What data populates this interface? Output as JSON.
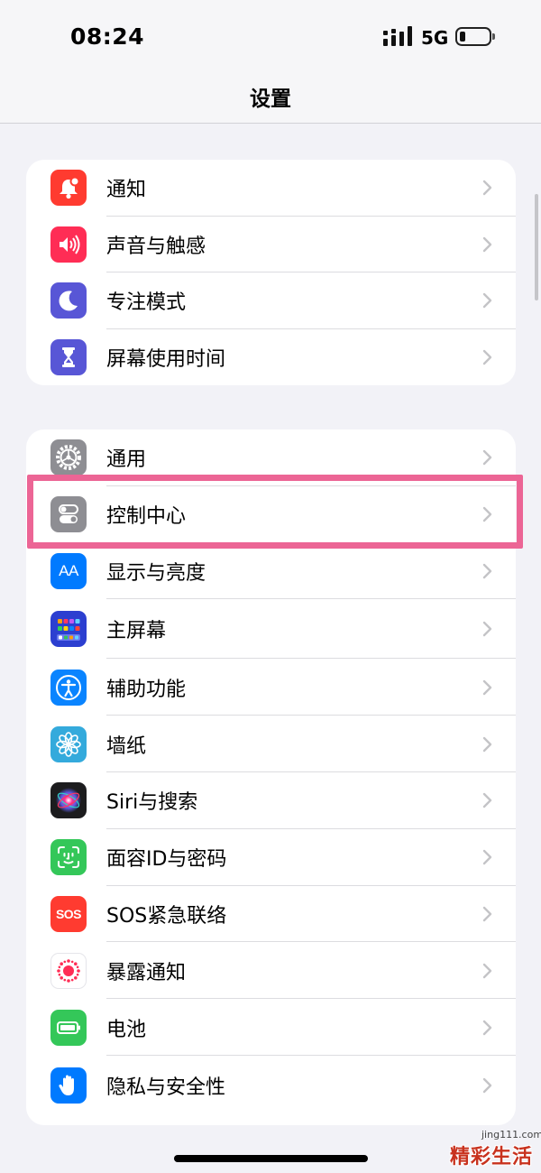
{
  "status_bar": {
    "time": "08:24",
    "network": "5G"
  },
  "header": {
    "title": "设置"
  },
  "groups": [
    {
      "items": [
        {
          "label": "通知",
          "icon": "bell-badge-icon",
          "color": "#ff3b30"
        },
        {
          "label": "声音与触感",
          "icon": "speaker-icon",
          "color": "#ff2d55"
        },
        {
          "label": "专注模式",
          "icon": "moon-icon",
          "color": "#5856d6"
        },
        {
          "label": "屏幕使用时间",
          "icon": "hourglass-icon",
          "color": "#5856d6"
        }
      ]
    },
    {
      "items": [
        {
          "label": "通用",
          "icon": "gear-icon",
          "color": "#8e8e93"
        },
        {
          "label": "控制中心",
          "icon": "toggles-icon",
          "color": "#8e8e93"
        },
        {
          "label": "显示与亮度",
          "icon": "text-size-icon",
          "color": "#007aff",
          "icon_text": "AA"
        },
        {
          "label": "主屏幕",
          "icon": "home-grid-icon",
          "color": "#2c3fd0"
        },
        {
          "label": "辅助功能",
          "icon": "accessibility-icon",
          "color": "#0a84ff"
        },
        {
          "label": "墙纸",
          "icon": "flower-icon",
          "color": "#34aadc"
        },
        {
          "label": "Siri与搜索",
          "icon": "siri-icon",
          "color": "#1c1c1e"
        },
        {
          "label": "面容ID与密码",
          "icon": "face-id-icon",
          "color": "#34c759"
        },
        {
          "label": "SOS紧急联络",
          "icon": "sos-icon",
          "color": "#ff3b30",
          "icon_text": "SOS"
        },
        {
          "label": "暴露通知",
          "icon": "exposure-icon",
          "color": "#ffffff"
        },
        {
          "label": "电池",
          "icon": "battery-icon",
          "color": "#34c759"
        },
        {
          "label": "隐私与安全性",
          "icon": "hand-icon",
          "color": "#007aff"
        }
      ]
    }
  ],
  "highlighted_item": "控制中心",
  "watermark": {
    "url": "jing111.com",
    "brand": "精彩生活"
  }
}
